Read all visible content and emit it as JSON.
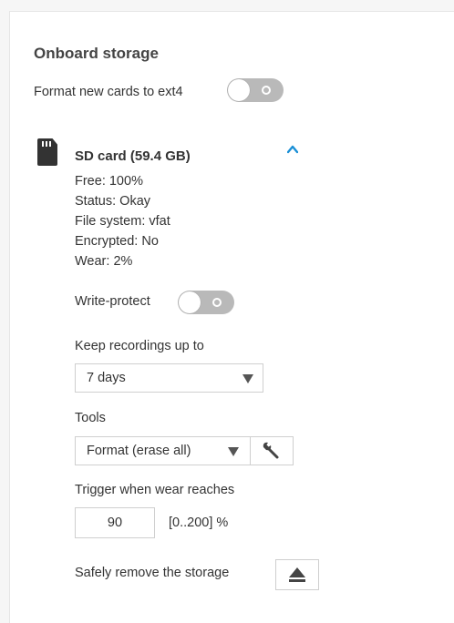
{
  "storage": {
    "section_title": "Onboard storage",
    "format_new_cards_label": "Format new cards to ext4",
    "format_new_cards_enabled": false
  },
  "card": {
    "title": "SD card (59.4 GB)",
    "free": "Free: 100%",
    "status": "Status: Okay",
    "file_system": "File system: vfat",
    "encrypted": "Encrypted: No",
    "wear": "Wear: 2%",
    "write_protect_label": "Write-protect",
    "write_protect_enabled": false,
    "keep_recordings_label": "Keep recordings up to",
    "keep_recordings_value": "7 days",
    "tools_label": "Tools",
    "tools_value": "Format (erase all)",
    "trigger_label": "Trigger when wear reaches",
    "trigger_value": "90",
    "trigger_range": "[0..200] %",
    "safely_remove_label": "Safely remove the storage"
  },
  "icons": {
    "sd_card": "sd-card-icon",
    "collapse": "chevron-up-icon",
    "tools_action": "wrench-icon",
    "eject": "eject-icon"
  },
  "colors": {
    "toggle_off": "#b9b9b9",
    "chevron": "#1a8fd6",
    "text": "#333333"
  }
}
